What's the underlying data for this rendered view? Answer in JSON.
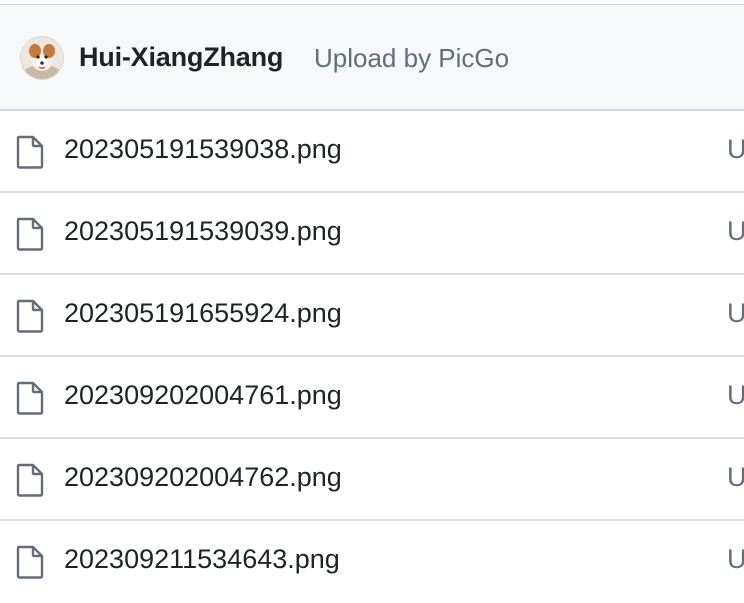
{
  "commit": {
    "author": "Hui-XiangZhang",
    "message": "Upload by PicGo"
  },
  "files": [
    {
      "name": "202305191539038.png",
      "commit_message": "U",
      "icon": "file-icon"
    },
    {
      "name": "202305191539039.png",
      "commit_message": "U",
      "icon": "file-icon"
    },
    {
      "name": "202305191655924.png",
      "commit_message": "U",
      "icon": "file-icon"
    },
    {
      "name": "202309202004761.png",
      "commit_message": "U",
      "icon": "file-icon"
    },
    {
      "name": "202309202004762.png",
      "commit_message": "U",
      "icon": "file-icon"
    },
    {
      "name": "202309211534643.png",
      "commit_message": "U",
      "icon": "file-icon"
    }
  ],
  "colors": {
    "header_bg": "#f6f8fa",
    "border": "#d0d7de",
    "text_primary": "#1f2328",
    "text_muted": "#656d76"
  }
}
